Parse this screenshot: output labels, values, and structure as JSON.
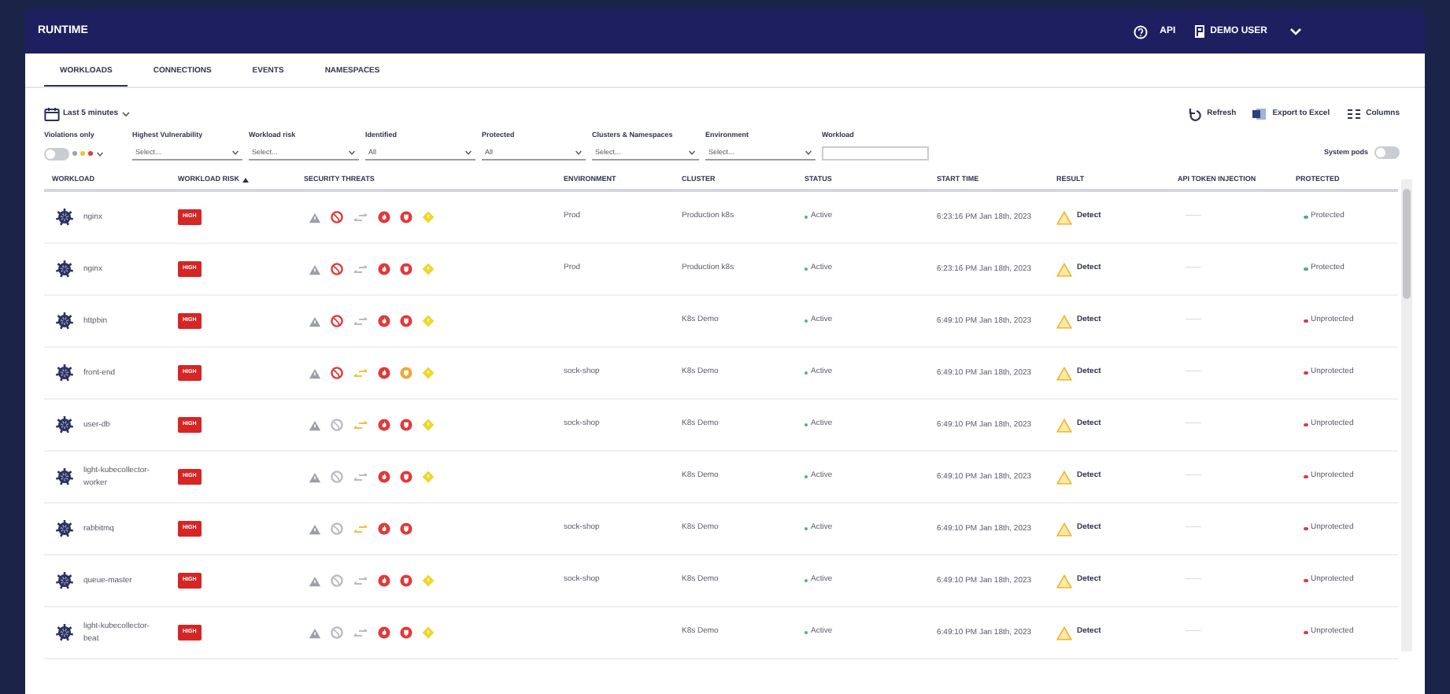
{
  "header": {
    "title": "RUNTIME",
    "api_label": "API",
    "user": "DEMO USER"
  },
  "tabs": [
    {
      "label": "WORKLOADS",
      "selected": true
    },
    {
      "label": "CONNECTIONS",
      "selected": false
    },
    {
      "label": "EVENTS",
      "selected": false
    },
    {
      "label": "NAMESPACES",
      "selected": false
    }
  ],
  "time_range": "Last 5 minutes",
  "actions": [
    "Refresh",
    "Export to Excel",
    "Columns"
  ],
  "filters": [
    {
      "kind": "toggle",
      "label": "Violations only",
      "on": false,
      "levels": [
        {
          "color": "#9aa3ad"
        },
        {
          "color": "#f2c230"
        },
        {
          "color": "#e03a3a"
        }
      ]
    },
    {
      "kind": "select",
      "label": "Highest Vulnerability",
      "value": "Select..."
    },
    {
      "kind": "select",
      "label": "Workload risk",
      "value": "Select..."
    },
    {
      "kind": "select",
      "label": "Identified",
      "value": "All"
    },
    {
      "kind": "select",
      "label": "Protected",
      "value": "All"
    },
    {
      "kind": "select",
      "label": "Clusters & Namespaces",
      "value": "Select..."
    },
    {
      "kind": "select",
      "label": "Environment",
      "value": "Select..."
    },
    {
      "kind": "text",
      "label": "Workload"
    }
  ],
  "system_pods": {
    "label": "System pods",
    "on": false
  },
  "table": {
    "columns": [
      "WORKLOAD",
      "WORKLOAD RISK",
      "SECURITY THREATS",
      "ENVIRONMENT",
      "CLUSTER",
      "STATUS",
      "START TIME",
      "RESULT",
      "API TOKEN INJECTION",
      "PROTECTED"
    ],
    "rows": [
      {
        "workload": "nginx",
        "risk": "HIGH",
        "threats": [
          {
            "kind": "warning",
            "color": "#9aa0a6"
          },
          {
            "kind": "globe",
            "color": "#e03a3a"
          },
          {
            "kind": "arrows",
            "color": "#b8bcc2"
          },
          {
            "kind": "fire",
            "color": "#e03a3a"
          },
          {
            "kind": "shield",
            "color": "#e03a3a"
          },
          {
            "kind": "diamond",
            "color": "#ecd82a"
          }
        ],
        "environment": "Prod",
        "cluster": "Production k8s",
        "status": "Active",
        "start_time": "6:23:16 PM Jan 18th, 2023",
        "result": "Detect",
        "api_token": "——",
        "protected": {
          "text": "Protected",
          "color": "#4caf7a"
        }
      },
      {
        "workload": "nginx",
        "risk": "HIGH",
        "threats": [
          {
            "kind": "warning",
            "color": "#9aa0a6"
          },
          {
            "kind": "globe",
            "color": "#e03a3a"
          },
          {
            "kind": "arrows",
            "color": "#b8bcc2"
          },
          {
            "kind": "fire",
            "color": "#e03a3a"
          },
          {
            "kind": "shield",
            "color": "#e03a3a"
          },
          {
            "kind": "diamond",
            "color": "#ecd82a"
          }
        ],
        "environment": "Prod",
        "cluster": "Production k8s",
        "status": "Active",
        "start_time": "6:23:16 PM Jan 18th, 2023",
        "result": "Detect",
        "api_token": "——",
        "protected": {
          "text": "Protected",
          "color": "#4caf7a"
        }
      },
      {
        "workload": "httpbin",
        "risk": "HIGH",
        "threats": [
          {
            "kind": "warning",
            "color": "#9aa0a6"
          },
          {
            "kind": "globe",
            "color": "#e03a3a"
          },
          {
            "kind": "arrows",
            "color": "#b8bcc2"
          },
          {
            "kind": "fire",
            "color": "#e03a3a"
          },
          {
            "kind": "shield",
            "color": "#e03a3a"
          },
          {
            "kind": "diamond",
            "color": "#ecd82a"
          }
        ],
        "cluster": "K8s Demo",
        "status": "Active",
        "start_time": "6:49:10 PM Jan 18th, 2023",
        "result": "Detect",
        "api_token": "——",
        "protected": {
          "text": "Unprotected",
          "color": "#e0344f"
        }
      },
      {
        "workload": "front-end",
        "risk": "HIGH",
        "threats": [
          {
            "kind": "warning",
            "color": "#9aa0a6"
          },
          {
            "kind": "globe",
            "color": "#e03a3a"
          },
          {
            "kind": "arrows",
            "color": "#f0c040"
          },
          {
            "kind": "fire",
            "color": "#e03a3a"
          },
          {
            "kind": "shield",
            "color": "#f0a830"
          },
          {
            "kind": "diamond",
            "color": "#ecd82a"
          }
        ],
        "environment": "sock-shop",
        "cluster": "K8s Demo",
        "status": "Active",
        "start_time": "6:49:10 PM Jan 18th, 2023",
        "result": "Detect",
        "api_token": "——",
        "protected": {
          "text": "Unprotected",
          "color": "#e0344f"
        }
      },
      {
        "workload": "user-db",
        "risk": "HIGH",
        "threats": [
          {
            "kind": "warning",
            "color": "#9aa0a6"
          },
          {
            "kind": "globe",
            "color": "#b8bcc2"
          },
          {
            "kind": "arrows",
            "color": "#f0c040"
          },
          {
            "kind": "fire",
            "color": "#e03a3a"
          },
          {
            "kind": "shield",
            "color": "#e03a3a"
          },
          {
            "kind": "diamond",
            "color": "#ecd82a"
          }
        ],
        "environment": "sock-shop",
        "cluster": "K8s Demo",
        "status": "Active",
        "start_time": "6:49:10 PM Jan 18th, 2023",
        "result": "Detect",
        "api_token": "——",
        "protected": {
          "text": "Unprotected",
          "color": "#e0344f"
        }
      },
      {
        "workload": "light-kubecollector-worker",
        "risk": "HIGH",
        "threats": [
          {
            "kind": "warning",
            "color": "#9aa0a6"
          },
          {
            "kind": "globe",
            "color": "#b8bcc2"
          },
          {
            "kind": "arrows",
            "color": "#b8bcc2"
          },
          {
            "kind": "fire",
            "color": "#e03a3a"
          },
          {
            "kind": "shield",
            "color": "#e03a3a"
          },
          {
            "kind": "diamond",
            "color": "#ecd82a"
          }
        ],
        "cluster": "K8s Demo",
        "status": "Active",
        "start_time": "6:49:10 PM Jan 18th, 2023",
        "result": "Detect",
        "api_token": "——",
        "protected": {
          "text": "Unprotected",
          "color": "#e0344f"
        }
      },
      {
        "workload": "rabbitmq",
        "risk": "HIGH",
        "threats": [
          {
            "kind": "warning",
            "color": "#9aa0a6"
          },
          {
            "kind": "globe",
            "color": "#b8bcc2"
          },
          {
            "kind": "arrows",
            "color": "#f0c040"
          },
          {
            "kind": "fire",
            "color": "#e03a3a"
          },
          {
            "kind": "shield",
            "color": "#e03a3a"
          }
        ],
        "environment": "sock-shop",
        "cluster": "K8s Demo",
        "status": "Active",
        "start_time": "6:49:10 PM Jan 18th, 2023",
        "result": "Detect",
        "api_token": "——",
        "protected": {
          "text": "Unprotected",
          "color": "#e0344f"
        }
      },
      {
        "workload": "queue-master",
        "risk": "HIGH",
        "threats": [
          {
            "kind": "warning",
            "color": "#9aa0a6"
          },
          {
            "kind": "globe",
            "color": "#b8bcc2"
          },
          {
            "kind": "arrows",
            "color": "#b8bcc2"
          },
          {
            "kind": "fire",
            "color": "#e03a3a"
          },
          {
            "kind": "shield",
            "color": "#e03a3a"
          },
          {
            "kind": "diamond",
            "color": "#ecd82a"
          }
        ],
        "environment": "sock-shop",
        "cluster": "K8s Demo",
        "status": "Active",
        "start_time": "6:49:10 PM Jan 18th, 2023",
        "result": "Detect",
        "api_token": "——",
        "protected": {
          "text": "Unprotected",
          "color": "#e0344f"
        }
      },
      {
        "workload": "light-kubecollector-beat",
        "risk": "HIGH",
        "threats": [
          {
            "kind": "warning",
            "color": "#9aa0a6"
          },
          {
            "kind": "globe",
            "color": "#b8bcc2"
          },
          {
            "kind": "arrows",
            "color": "#b8bcc2"
          },
          {
            "kind": "fire",
            "color": "#e03a3a"
          },
          {
            "kind": "shield",
            "color": "#e03a3a"
          },
          {
            "kind": "diamond",
            "color": "#ecd82a"
          }
        ],
        "cluster": "K8s Demo",
        "status": "Active",
        "start_time": "6:49:10 PM Jan 18th, 2023",
        "result": "Detect",
        "api_token": "——",
        "protected": {
          "text": "Unprotected",
          "color": "#e0344f"
        }
      }
    ]
  }
}
